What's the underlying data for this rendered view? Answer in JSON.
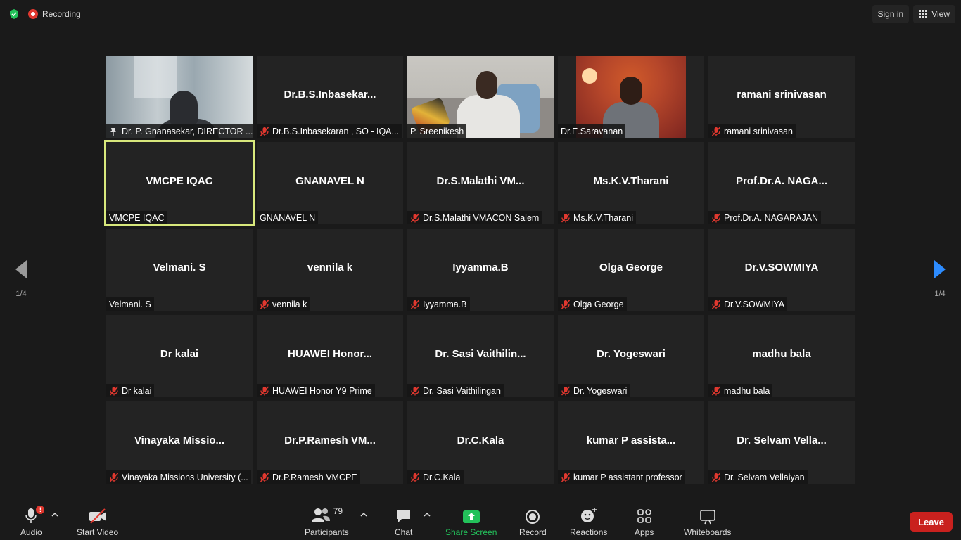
{
  "topbar": {
    "recording_label": "Recording",
    "sign_in_label": "Sign in",
    "view_label": "View"
  },
  "pager": {
    "left_label": "1/4",
    "right_label": "1/4"
  },
  "participants": [
    {
      "title": "",
      "label": "Dr. P. Gnanasekar, DIRECTOR ...",
      "video": "vid1",
      "pinned": true,
      "muted": false
    },
    {
      "title": "Dr.B.S.Inbasekar...",
      "label": "Dr.B.S.Inbasekaran , SO - IQA...",
      "muted": true
    },
    {
      "title": "",
      "label": "P. Sreenikesh",
      "video": "vid3",
      "muted": false
    },
    {
      "title": "",
      "label": "Dr.E.Saravanan",
      "video": "vid4",
      "muted": false
    },
    {
      "title": "ramani srinivasan",
      "label": "ramani srinivasan",
      "muted": true
    },
    {
      "title": "VMCPE IQAC",
      "label": "VMCPE IQAC",
      "muted": false,
      "active": true
    },
    {
      "title": "GNANAVEL N",
      "label": "GNANAVEL N",
      "muted": false
    },
    {
      "title": "Dr.S.Malathi  VM...",
      "label": "Dr.S.Malathi VMACON Salem",
      "muted": true
    },
    {
      "title": "Ms.K.V.Tharani",
      "label": "Ms.K.V.Tharani",
      "muted": true
    },
    {
      "title": "Prof.Dr.A.  NAGA...",
      "label": "Prof.Dr.A. NAGARAJAN",
      "muted": true
    },
    {
      "title": "Velmani. S",
      "label": "Velmani. S",
      "muted": false
    },
    {
      "title": "vennila k",
      "label": "vennila k",
      "muted": true
    },
    {
      "title": "Iyyamma.B",
      "label": "Iyyamma.B",
      "muted": true
    },
    {
      "title": "Olga George",
      "label": "Olga George",
      "muted": true
    },
    {
      "title": "Dr.V.SOWMIYA",
      "label": "Dr.V.SOWMIYA",
      "muted": true
    },
    {
      "title": "Dr kalai",
      "label": "Dr kalai",
      "muted": true
    },
    {
      "title": "HUAWEI  Honor...",
      "label": "HUAWEI Honor Y9 Prime",
      "muted": true
    },
    {
      "title": "Dr.  Sasi  Vaithilin...",
      "label": "Dr. Sasi Vaithilingan",
      "muted": true
    },
    {
      "title": "Dr. Yogeswari",
      "label": "Dr. Yogeswari",
      "muted": true
    },
    {
      "title": "madhu bala",
      "label": "madhu bala",
      "muted": true
    },
    {
      "title": "Vinayaka  Missio...",
      "label": "Vinayaka Missions University (...",
      "muted": true
    },
    {
      "title": "Dr.P.Ramesh  VM...",
      "label": "Dr.P.Ramesh VMCPE",
      "muted": true
    },
    {
      "title": "Dr.C.Kala",
      "label": "Dr.C.Kala",
      "muted": true
    },
    {
      "title": "kumar P assista...",
      "label": "kumar P assistant professor",
      "muted": true
    },
    {
      "title": "Dr.  Selvam  Vella...",
      "label": "Dr. Selvam Vellaiyan",
      "muted": true
    }
  ],
  "toolbar": {
    "audio_label": "Audio",
    "audio_badge": "!",
    "video_label": "Start Video",
    "participants_label": "Participants",
    "participants_count": "79",
    "chat_label": "Chat",
    "share_label": "Share Screen",
    "record_label": "Record",
    "reactions_label": "Reactions",
    "apps_label": "Apps",
    "whiteboards_label": "Whiteboards",
    "leave_label": "Leave"
  },
  "colors": {
    "background": "#1a1a1a",
    "tile": "#232323",
    "active_border": "#d8e87c",
    "share_green": "#23c15a",
    "leave_red": "#c9211e",
    "mute_red": "#e0382f"
  }
}
